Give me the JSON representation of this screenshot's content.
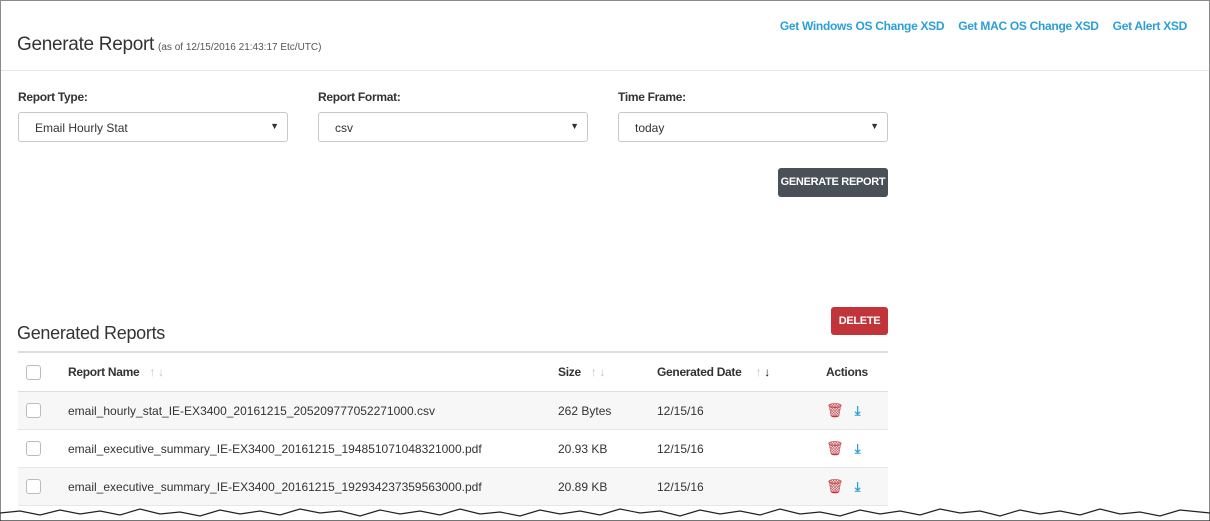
{
  "header": {
    "title": "Generate Report",
    "timestamp": "(as of 12/15/2016 21:43:17 Etc/UTC)",
    "links": [
      "Get Windows OS Change XSD",
      "Get MAC OS Change XSD",
      "Get Alert XSD"
    ]
  },
  "form": {
    "report_type_label": "Report Type:",
    "report_type_value": "Email Hourly Stat",
    "report_format_label": "Report Format:",
    "report_format_value": "csv",
    "time_frame_label": "Time Frame:",
    "time_frame_value": "today",
    "generate_button": "GENERATE REPORT"
  },
  "generated": {
    "title": "Generated Reports",
    "delete_button": "DELETE",
    "columns": {
      "name": "Report Name",
      "size": "Size",
      "date": "Generated Date",
      "actions": "Actions"
    },
    "rows": [
      {
        "name": "email_hourly_stat_IE-EX3400_20161215_205209777052271000.csv",
        "size": "262 Bytes",
        "date": "12/15/16"
      },
      {
        "name": "email_executive_summary_IE-EX3400_20161215_194851071048321000.pdf",
        "size": "20.93 KB",
        "date": "12/15/16"
      },
      {
        "name": "email_executive_summary_IE-EX3400_20161215_192934237359563000.pdf",
        "size": "20.89 KB",
        "date": "12/15/16"
      }
    ]
  },
  "icons": {
    "sort_up": "↑",
    "sort_down": "↓",
    "trash": "🗑",
    "download": "⤓",
    "caret": "▼"
  },
  "colors": {
    "link": "#2a9fd8",
    "generate_button": "#4a5058",
    "delete_button": "#c0343a",
    "trash_icon": "#c0343a",
    "download_icon": "#2a9fd8"
  }
}
